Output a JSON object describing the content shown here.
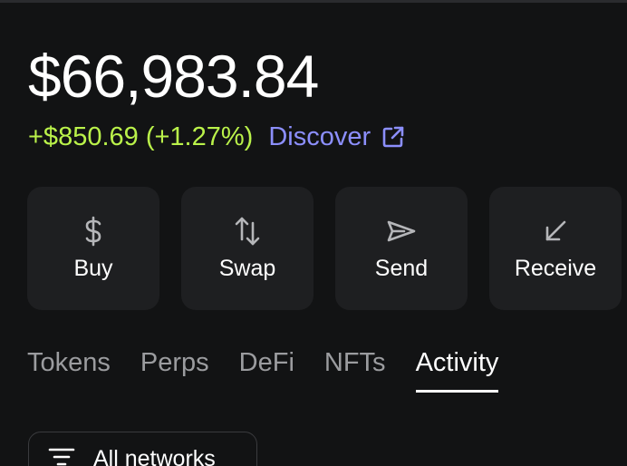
{
  "balance": {
    "total": "$66,983.84",
    "change": "+$850.69 (+1.27%)",
    "discover_label": "Discover",
    "discover_icon": "external-link-icon",
    "change_color": "#baf24a",
    "link_color": "#8c8ffd"
  },
  "actions": [
    {
      "label": "Buy",
      "icon": "dollar-icon"
    },
    {
      "label": "Swap",
      "icon": "swap-arrows-icon"
    },
    {
      "label": "Send",
      "icon": "send-icon"
    },
    {
      "label": "Receive",
      "icon": "receive-arrow-icon"
    }
  ],
  "tabs": [
    {
      "label": "Tokens",
      "active": false
    },
    {
      "label": "Perps",
      "active": false
    },
    {
      "label": "DeFi",
      "active": false
    },
    {
      "label": "NFTs",
      "active": false
    },
    {
      "label": "Activity",
      "active": true
    }
  ],
  "filter": {
    "label": "All networks",
    "icon": "filter-lines-icon"
  }
}
